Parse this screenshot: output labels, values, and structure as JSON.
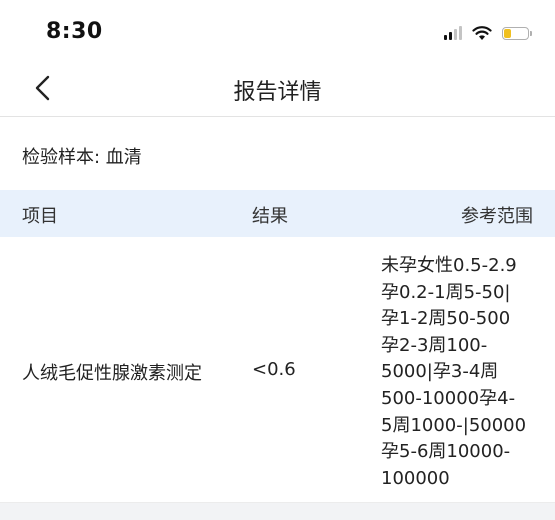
{
  "status_bar": {
    "time": "8:30",
    "battery_level": 0.35,
    "battery_color": "#f0c020"
  },
  "nav": {
    "back_icon": "chevron-left-icon",
    "title": "报告详情"
  },
  "sample": {
    "label": "检验样本: 血清"
  },
  "table": {
    "header_bg": "#e8f1fc",
    "headers": {
      "item": "项目",
      "result": "结果",
      "range": "参考范围"
    },
    "rows": [
      {
        "item": "人绒毛促性腺激素测定",
        "result": "<0.6",
        "range_lines": [
          "未孕女性0.5-2.9",
          "孕0.2-1周5-50|",
          "孕1-2周50-500",
          "孕2-3周100-",
          "5000|孕3-4周",
          "500-10000孕4-",
          "5周1000-|50000",
          "孕5-6周10000-",
          "100000"
        ]
      }
    ]
  }
}
